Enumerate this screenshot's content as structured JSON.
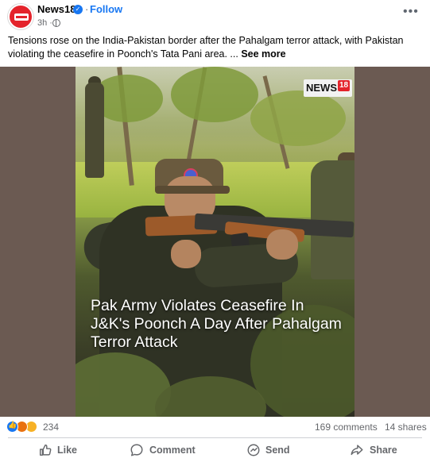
{
  "post": {
    "page_name": "News18",
    "separator": "·",
    "follow_label": "Follow",
    "time": "3h ·",
    "caption": "Tensions rose on the India-Pakistan border after the Pahalgam terror attack, with Pakistan violating the ceasefire in Poonch's Tata Pani area. ...",
    "see_more": "See more"
  },
  "media": {
    "logo_text": "NEWS",
    "logo_number": "18",
    "headline": "Pak Army Violates Ceasefire In J&K's Poonch A Day After Pahalgam Terror Attack"
  },
  "stats": {
    "reaction_count": "234",
    "comments": "169 comments",
    "shares": "14 shares"
  },
  "actions": {
    "like": "Like",
    "comment": "Comment",
    "send": "Send",
    "share": "Share"
  },
  "colors": {
    "accent": "#1877f2",
    "brand_red": "#e4232b",
    "secondary_text": "#65676b",
    "media_background": "#6b5a52"
  },
  "icons": [
    "verified-badge-icon",
    "globe-icon",
    "more-options-icon",
    "like-reaction-icon",
    "angry-reaction-icon",
    "haha-reaction-icon",
    "like-icon",
    "comment-icon",
    "send-icon",
    "share-icon"
  ]
}
